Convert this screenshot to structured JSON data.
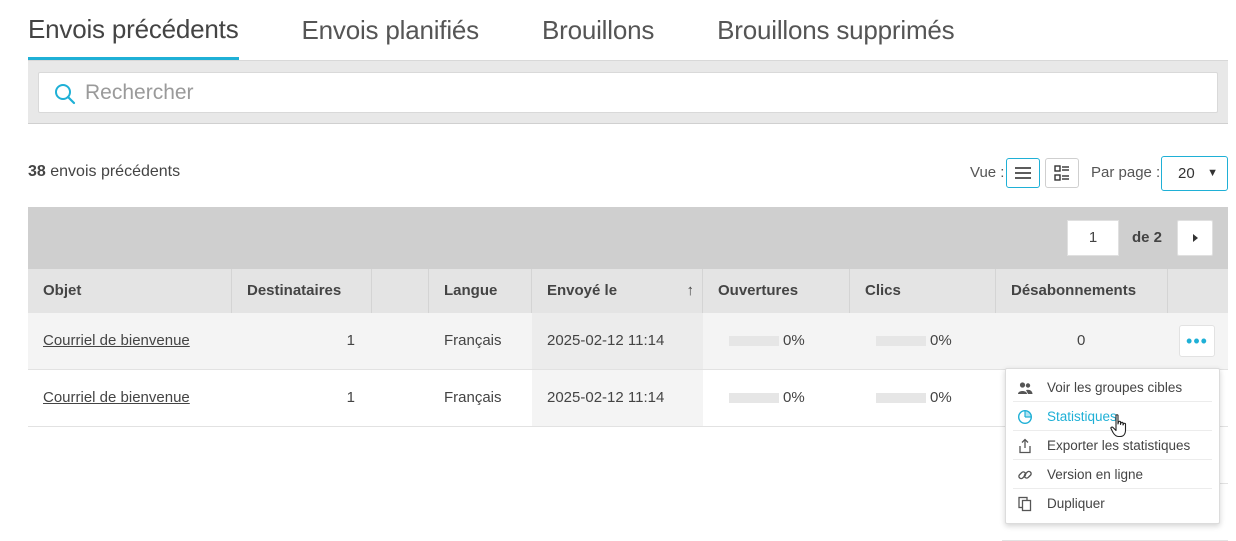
{
  "tabs": [
    {
      "label": "Envois précédents",
      "active": true
    },
    {
      "label": "Envois planifiés",
      "active": false
    },
    {
      "label": "Brouillons",
      "active": false
    },
    {
      "label": "Brouillons supprimés",
      "active": false
    }
  ],
  "search": {
    "placeholder": "Rechercher",
    "value": ""
  },
  "summary": {
    "count": "38",
    "label": "envois précédents"
  },
  "view": {
    "label": "Vue :",
    "modes": [
      "list-icon",
      "grid-icon"
    ],
    "active_mode": "list-icon"
  },
  "per_page": {
    "label": "Par page :",
    "value": "20"
  },
  "pagination": {
    "current": "1",
    "of_label": "de 2"
  },
  "table": {
    "columns": [
      "Objet",
      "Destinataires",
      "",
      "Langue",
      "Envoyé le",
      "Ouvertures",
      "Clics",
      "Désabonnements",
      ""
    ],
    "sort_column": "Envoyé le",
    "sort_arrow": "↑",
    "rows": [
      {
        "subject": "Courriel de bienvenue",
        "recipients": "1",
        "language": "Français",
        "sent": "2025-02-12 11:14",
        "opens": "0%",
        "opens_fraction": 0,
        "clicks": "0%",
        "clicks_fraction": 0,
        "unsubs": "0",
        "menu_open": true
      },
      {
        "subject": "Courriel de bienvenue",
        "recipients": "1",
        "language": "Français",
        "sent": "2025-02-12 11:14",
        "opens": "0%",
        "opens_fraction": 0,
        "clicks": "0%",
        "clicks_fraction": 0,
        "unsubs": "",
        "menu_open": false
      }
    ]
  },
  "more_button": {
    "label": "•••"
  },
  "row_menu": {
    "items": [
      {
        "label": "Voir les groupes cibles",
        "icon": "users-icon"
      },
      {
        "label": "Statistiques",
        "icon": "pie-chart-icon",
        "hover": true
      },
      {
        "label": "Exporter les statistiques",
        "icon": "export-icon"
      },
      {
        "label": "Version en ligne",
        "icon": "link-icon"
      },
      {
        "label": "Dupliquer",
        "icon": "duplicate-icon"
      }
    ]
  },
  "colors": {
    "accent": "#1fb0d6",
    "band": "#cfcfcf",
    "header": "#e4e4e4"
  }
}
